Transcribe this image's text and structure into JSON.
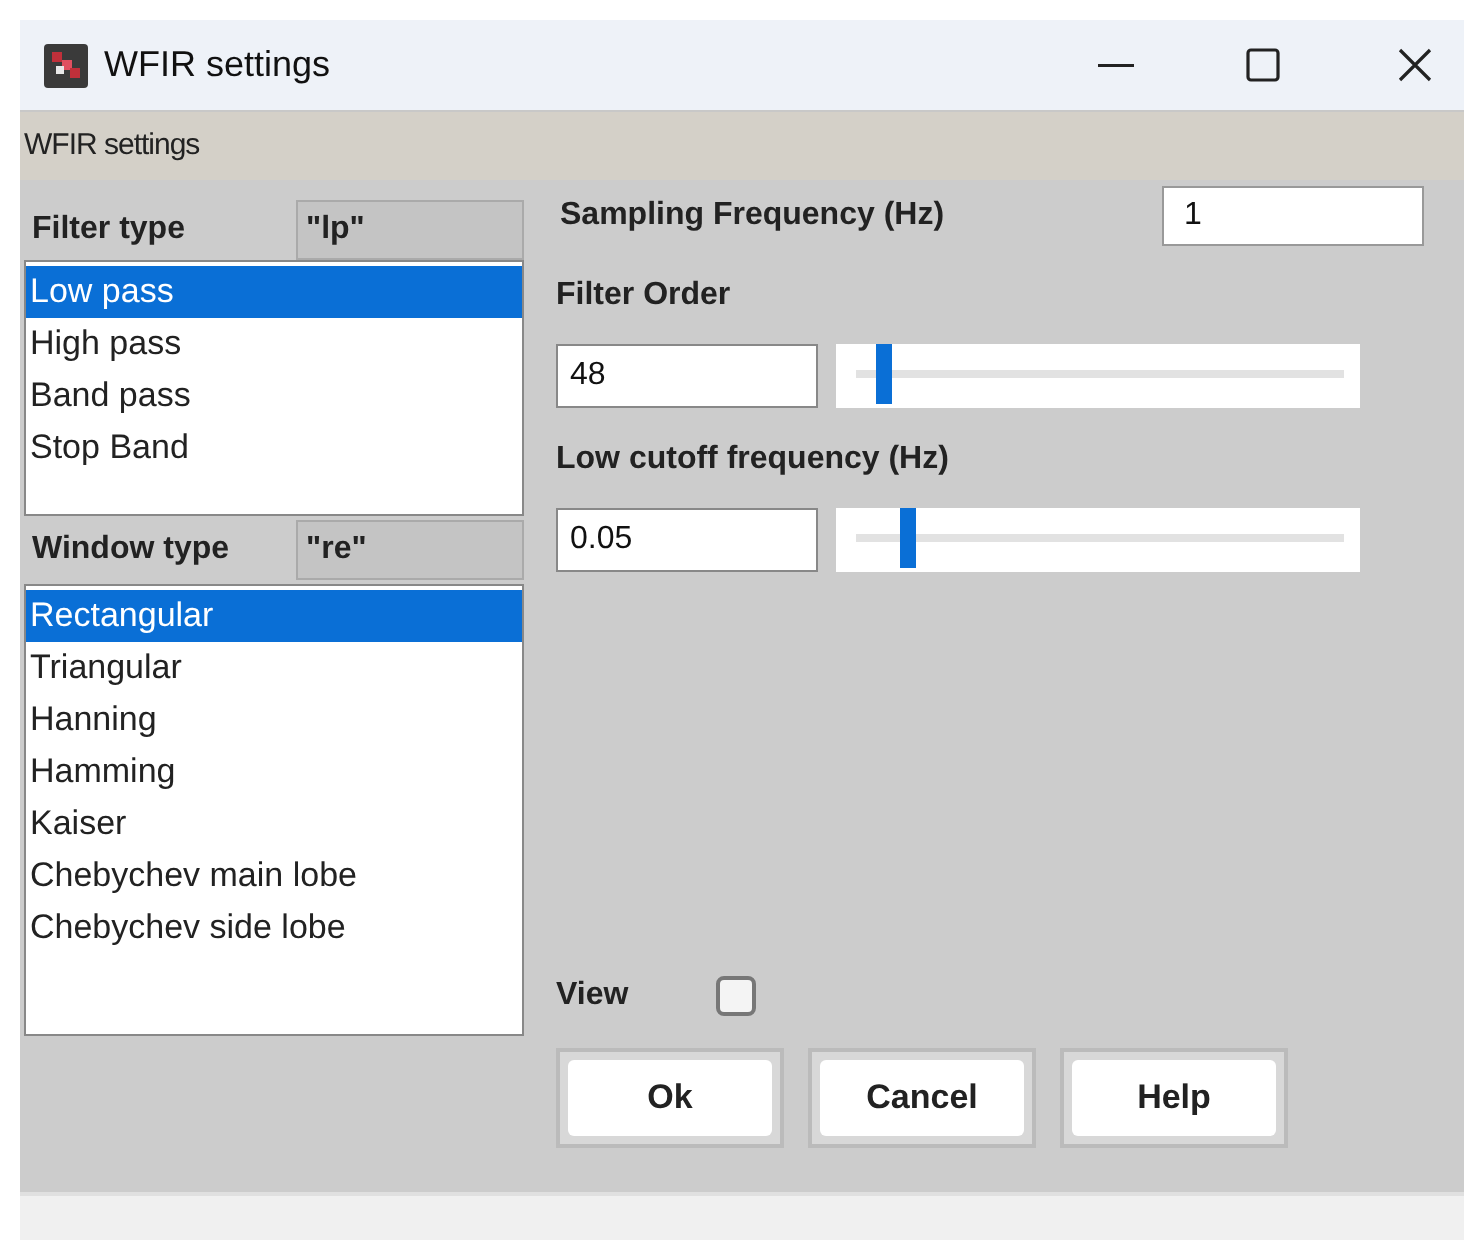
{
  "window": {
    "title": "WFIR settings"
  },
  "header": {
    "title": "WFIR settings"
  },
  "filter_type": {
    "label": "Filter type",
    "code": "\"lp\"",
    "items": [
      {
        "label": "Low pass",
        "selected": true
      },
      {
        "label": "High pass",
        "selected": false
      },
      {
        "label": "Band pass",
        "selected": false
      },
      {
        "label": "Stop Band",
        "selected": false
      }
    ]
  },
  "window_type": {
    "label": "Window type",
    "code": "\"re\"",
    "items": [
      {
        "label": "Rectangular",
        "selected": true
      },
      {
        "label": "Triangular",
        "selected": false
      },
      {
        "label": "Hanning",
        "selected": false
      },
      {
        "label": "Hamming",
        "selected": false
      },
      {
        "label": "Kaiser",
        "selected": false
      },
      {
        "label": "Chebychev main lobe",
        "selected": false
      },
      {
        "label": "Chebychev side lobe",
        "selected": false
      }
    ]
  },
  "sampling_frequency": {
    "label": "Sampling Frequency (Hz)",
    "value": "1"
  },
  "filter_order": {
    "label": "Filter Order",
    "value": "48",
    "level": 0.04
  },
  "low_cutoff": {
    "label": "Low cutoff frequency (Hz)",
    "value": "0.05",
    "level": 0.09
  },
  "view": {
    "label": "View",
    "checked": false
  },
  "buttons": [
    "Ok",
    "Cancel",
    "Help"
  ]
}
